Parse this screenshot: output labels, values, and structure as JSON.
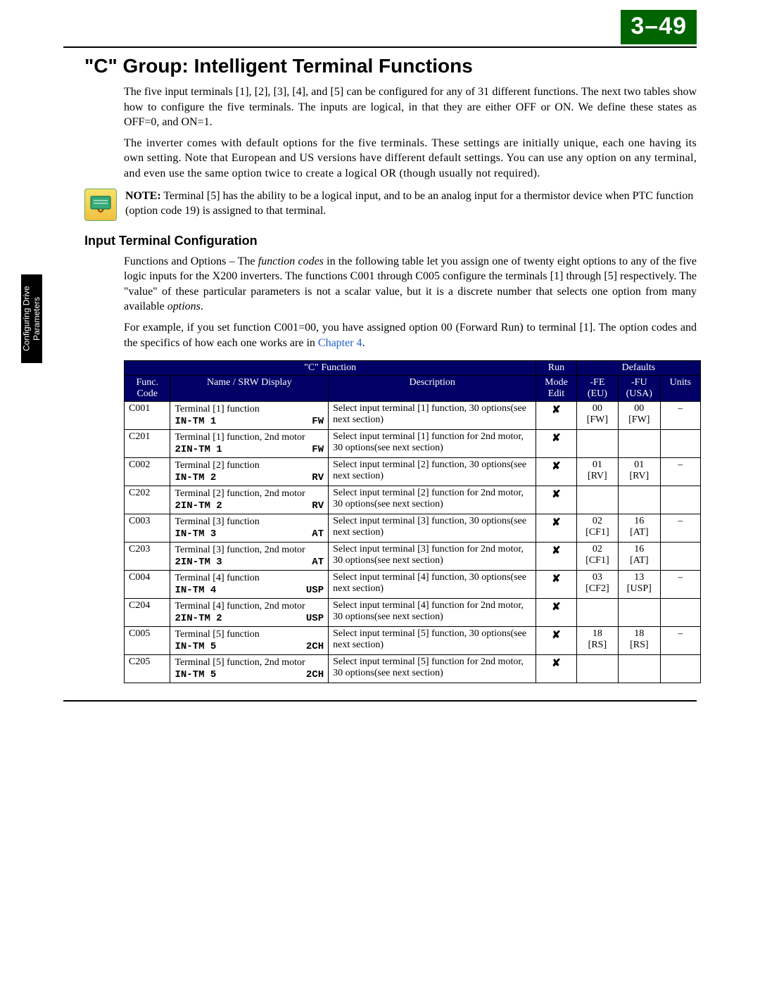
{
  "page_number": "3–49",
  "side_tab": "Configuring Drive Parameters",
  "section_title": "\"C\" Group: Intelligent Terminal Functions",
  "para1": "The five input terminals [1], [2], [3], [4], and [5] can be configured for any of 31 different functions. The next two tables show how to configure the five terminals. The inputs are logical, in that they are either OFF or ON. We define these states as OFF=0, and ON=1.",
  "para2": "The inverter comes with default options for the five terminals. These settings are initially unique, each one having its own setting. Note that European and US versions have different default settings. You can use any option on any terminal, and even use the same option twice to create a logical OR (though usually not required).",
  "note_label": "NOTE:",
  "note_text": " Terminal [5] has the ability to be a logical input, and to be an analog input for a thermistor device when PTC function (option code 19) is assigned to that terminal.",
  "subheading": "Input Terminal Configuration",
  "para3a": "Functions and Options – The ",
  "para3b": "function codes",
  "para3c": " in the following table let you assign one of twenty eight options to any of the five logic inputs for the X200 inverters. The functions C001 through C005 configure the terminals [1] through [5] respectively. The \"value\" of these particular parameters is not a scalar value, but it is a discrete number that selects one option from many available ",
  "para3d": "options",
  "para3e": ".",
  "para4a": "For example, if you set function C001=00, you have assigned option 00 (Forward Run) to terminal [1]. The option codes and the specifics of how each one works are in ",
  "para4link": "Chapter 4",
  "para4b": ".",
  "table": {
    "headers": {
      "c_function": "\"C\" Function",
      "run": "Run",
      "defaults": "Defaults",
      "func_code": "Func. Code",
      "name": "Name / SRW Display",
      "desc": "Description",
      "mode_edit": "Mode Edit",
      "fe": "-FE (EU)",
      "fu": "-FU (USA)",
      "units": "Units"
    },
    "rows": [
      {
        "code": "C001",
        "name": "Terminal [1] function",
        "srw_l": "IN-TM 1",
        "srw_r": "FW",
        "desc": "Select input terminal [1] function, 30 options(see next section)",
        "x": "✘",
        "fe": "00",
        "fe2": "[FW]",
        "fu": "00",
        "fu2": "[FW]",
        "units": "–"
      },
      {
        "code": "C201",
        "name": "Terminal [1] function, 2nd motor",
        "srw_l": "2IN-TM 1",
        "srw_r": "FW",
        "desc": "Select input terminal [1] function for 2nd motor, 30 options(see next section)",
        "x": "✘",
        "fe": "",
        "fe2": "",
        "fu": "",
        "fu2": "",
        "units": ""
      },
      {
        "code": "C002",
        "name": "Terminal [2] function",
        "srw_l": "IN-TM 2",
        "srw_r": "RV",
        "desc": "Select input terminal [2] function, 30 options(see next section)",
        "x": "✘",
        "fe": "01",
        "fe2": "[RV]",
        "fu": "01",
        "fu2": "[RV]",
        "units": "–"
      },
      {
        "code": "C202",
        "name": "Terminal [2] function, 2nd motor",
        "srw_l": "2IN-TM 2",
        "srw_r": "RV",
        "desc": "Select input terminal [2] function for 2nd motor, 30 options(see next section)",
        "x": "✘",
        "fe": "",
        "fe2": "",
        "fu": "",
        "fu2": "",
        "units": ""
      },
      {
        "code": "C003",
        "name": "Terminal [3] function",
        "srw_l": "IN-TM 3",
        "srw_r": "AT",
        "desc": "Select input terminal [3] function, 30 options(see next section)",
        "x": "✘",
        "fe": "02",
        "fe2": "[CF1]",
        "fu": "16",
        "fu2": "[AT]",
        "units": "–"
      },
      {
        "code": "C203",
        "name": "Terminal [3] function, 2nd motor",
        "srw_l": "2IN-TM 3",
        "srw_r": "AT",
        "desc": "Select input terminal [3] function for 2nd motor, 30 options(see next section)",
        "x": "✘",
        "fe": "02",
        "fe2": "[CF1]",
        "fu": "16",
        "fu2": "[AT]",
        "units": ""
      },
      {
        "code": "C004",
        "name": "Terminal [4] function",
        "srw_l": "IN-TM 4",
        "srw_r": "USP",
        "desc": "Select input terminal [4] function, 30 options(see next section)",
        "x": "✘",
        "fe": "03",
        "fe2": "[CF2]",
        "fu": "13",
        "fu2": "[USP]",
        "units": "–"
      },
      {
        "code": "C204",
        "name": "Terminal [4] function, 2nd motor",
        "srw_l": "2IN-TM 2",
        "srw_r": "USP",
        "desc": "Select input terminal [4] function for 2nd motor, 30 options(see next section)",
        "x": "✘",
        "fe": "",
        "fe2": "",
        "fu": "",
        "fu2": "",
        "units": ""
      },
      {
        "code": "C005",
        "name": "Terminal [5] function",
        "srw_l": "IN-TM 5",
        "srw_r": "2CH",
        "desc": "Select input terminal [5] function, 30 options(see next section)",
        "x": "✘",
        "fe": "18",
        "fe2": "[RS]",
        "fu": "18",
        "fu2": "[RS]",
        "units": "–"
      },
      {
        "code": "C205",
        "name": "Terminal [5] function, 2nd motor",
        "srw_l": "IN-TM 5",
        "srw_r": "2CH",
        "desc": "Select input terminal [5] function for 2nd motor, 30 options(see next section)",
        "x": "✘",
        "fe": "",
        "fe2": "",
        "fu": "",
        "fu2": "",
        "units": ""
      }
    ]
  }
}
